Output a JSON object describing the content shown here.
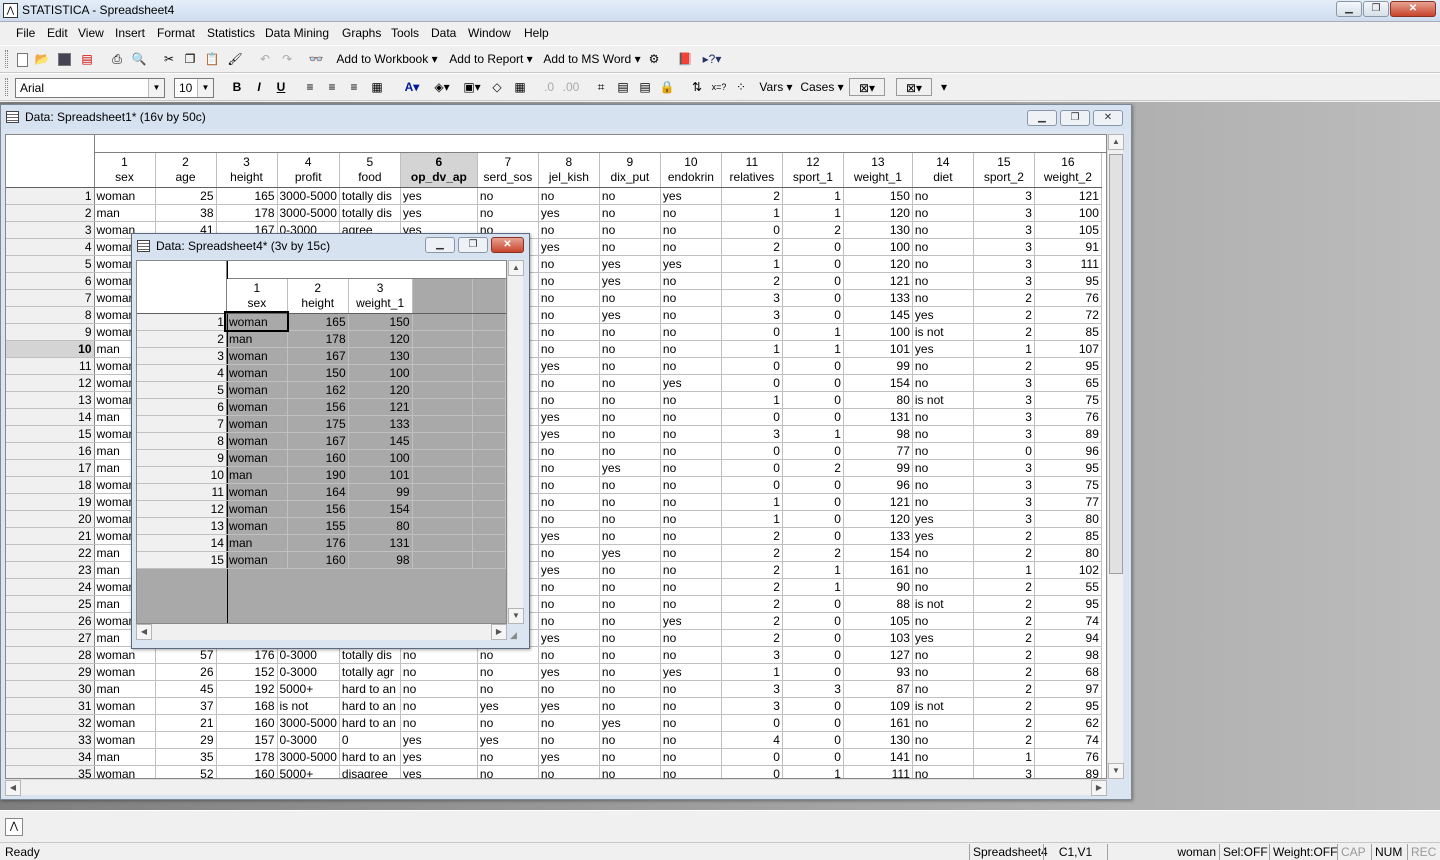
{
  "app": {
    "title": "STATISTICA - Spreadsheet4",
    "icon": "statistica-app-icon"
  },
  "menu": [
    "File",
    "Edit",
    "View",
    "Insert",
    "Format",
    "Statistics",
    "Data Mining",
    "Graphs",
    "Tools",
    "Data",
    "Window",
    "Help"
  ],
  "toolbar1": {
    "add_workbook": "Add to Workbook",
    "add_report": "Add to Report",
    "add_msword": "Add to MS Word"
  },
  "toolbar2": {
    "font": "Arial",
    "size": "10",
    "bold": "B",
    "italic": "I",
    "underline": "U",
    "vars": "Vars",
    "cases": "Cases"
  },
  "win1": {
    "title": "Data: Spreadsheet1* (16v by 50c)",
    "col_nums": [
      "1",
      "2",
      "3",
      "4",
      "5",
      "6",
      "7",
      "8",
      "9",
      "10",
      "11",
      "12",
      "13",
      "14",
      "15",
      "16"
    ],
    "col_names": [
      "sex",
      "age",
      "height",
      "profit",
      "food",
      "op_dv_ap",
      "serd_sos",
      "jel_kish",
      "dix_put",
      "endokrin",
      "relatives",
      "sport_1",
      "weight_1",
      "diet",
      "sport_2",
      "weight_2"
    ],
    "rows": [
      [
        "1",
        "woman",
        "25",
        "165",
        "3000-5000",
        "totally dis",
        "yes",
        "no",
        "no",
        "no",
        "yes",
        "2",
        "1",
        "150",
        "no",
        "3",
        "121"
      ],
      [
        "2",
        "man",
        "38",
        "178",
        "3000-5000",
        "totally dis",
        "yes",
        "no",
        "yes",
        "no",
        "no",
        "1",
        "1",
        "120",
        "no",
        "3",
        "100"
      ],
      [
        "3",
        "woman",
        "41",
        "167",
        "0-3000",
        "agree",
        "yes",
        "no",
        "no",
        "no",
        "no",
        "0",
        "2",
        "130",
        "no",
        "3",
        "105"
      ],
      [
        "4",
        "woman",
        "",
        "",
        "",
        "",
        "",
        "",
        "yes",
        "no",
        "no",
        "2",
        "0",
        "100",
        "no",
        "3",
        "91"
      ],
      [
        "5",
        "woman",
        "",
        "",
        "",
        "",
        "",
        "",
        "no",
        "yes",
        "yes",
        "1",
        "0",
        "120",
        "no",
        "3",
        "111"
      ],
      [
        "6",
        "woman",
        "",
        "",
        "",
        "",
        "",
        "",
        "no",
        "yes",
        "no",
        "2",
        "0",
        "121",
        "no",
        "3",
        "95"
      ],
      [
        "7",
        "woman",
        "",
        "",
        "",
        "",
        "",
        "",
        "no",
        "no",
        "no",
        "3",
        "0",
        "133",
        "no",
        "2",
        "76"
      ],
      [
        "8",
        "woman",
        "",
        "",
        "",
        "",
        "",
        "",
        "no",
        "yes",
        "no",
        "3",
        "0",
        "145",
        "yes",
        "2",
        "72"
      ],
      [
        "9",
        "woman",
        "",
        "",
        "",
        "",
        "",
        "",
        "no",
        "no",
        "no",
        "0",
        "1",
        "100",
        "is not",
        "2",
        "85"
      ],
      [
        "10",
        "man",
        "",
        "",
        "",
        "",
        "",
        "",
        "no",
        "no",
        "no",
        "1",
        "1",
        "101",
        "yes",
        "1",
        "107"
      ],
      [
        "11",
        "woman",
        "",
        "",
        "",
        "",
        "",
        "",
        "yes",
        "no",
        "no",
        "0",
        "0",
        "99",
        "no",
        "2",
        "95"
      ],
      [
        "12",
        "woman",
        "",
        "",
        "",
        "",
        "",
        "",
        "no",
        "no",
        "yes",
        "0",
        "0",
        "154",
        "no",
        "3",
        "65"
      ],
      [
        "13",
        "woman",
        "",
        "",
        "",
        "",
        "",
        "",
        "no",
        "no",
        "no",
        "1",
        "0",
        "80",
        "is not",
        "3",
        "75"
      ],
      [
        "14",
        "man",
        "",
        "",
        "",
        "",
        "",
        "",
        "yes",
        "no",
        "no",
        "0",
        "0",
        "131",
        "no",
        "3",
        "76"
      ],
      [
        "15",
        "woman",
        "",
        "",
        "",
        "",
        "",
        "",
        "yes",
        "no",
        "no",
        "3",
        "1",
        "98",
        "no",
        "3",
        "89"
      ],
      [
        "16",
        "man",
        "",
        "",
        "",
        "",
        "",
        "",
        "no",
        "no",
        "no",
        "0",
        "0",
        "77",
        "no",
        "0",
        "96"
      ],
      [
        "17",
        "man",
        "",
        "",
        "",
        "",
        "",
        "",
        "no",
        "yes",
        "no",
        "0",
        "2",
        "99",
        "no",
        "3",
        "95"
      ],
      [
        "18",
        "woman",
        "",
        "",
        "",
        "",
        "",
        "",
        "no",
        "no",
        "no",
        "0",
        "0",
        "96",
        "no",
        "3",
        "75"
      ],
      [
        "19",
        "woman",
        "",
        "",
        "",
        "",
        "",
        "",
        "no",
        "no",
        "no",
        "1",
        "0",
        "121",
        "no",
        "3",
        "77"
      ],
      [
        "20",
        "woman",
        "",
        "",
        "",
        "",
        "",
        "",
        "no",
        "no",
        "no",
        "1",
        "0",
        "120",
        "yes",
        "3",
        "80"
      ],
      [
        "21",
        "woman",
        "",
        "",
        "",
        "",
        "",
        "",
        "yes",
        "no",
        "no",
        "2",
        "0",
        "133",
        "yes",
        "2",
        "85"
      ],
      [
        "22",
        "man",
        "",
        "",
        "",
        "",
        "",
        "",
        "no",
        "yes",
        "no",
        "2",
        "2",
        "154",
        "no",
        "2",
        "80"
      ],
      [
        "23",
        "man",
        "",
        "",
        "",
        "",
        "",
        "",
        "yes",
        "no",
        "no",
        "2",
        "1",
        "161",
        "no",
        "1",
        "102"
      ],
      [
        "24",
        "woman",
        "",
        "",
        "",
        "",
        "",
        "",
        "no",
        "no",
        "no",
        "2",
        "1",
        "90",
        "no",
        "2",
        "55"
      ],
      [
        "25",
        "man",
        "",
        "",
        "",
        "",
        "",
        "",
        "no",
        "no",
        "no",
        "2",
        "0",
        "88",
        "is not",
        "2",
        "95"
      ],
      [
        "26",
        "woman",
        "",
        "",
        "",
        "",
        "",
        "",
        "no",
        "no",
        "yes",
        "2",
        "0",
        "105",
        "no",
        "2",
        "74"
      ],
      [
        "27",
        "man",
        "",
        "",
        "",
        "",
        "",
        "",
        "yes",
        "no",
        "no",
        "2",
        "0",
        "103",
        "yes",
        "2",
        "94"
      ],
      [
        "28",
        "woman",
        "57",
        "176",
        "0-3000",
        "totally dis",
        "no",
        "no",
        "no",
        "no",
        "no",
        "3",
        "0",
        "127",
        "no",
        "2",
        "98"
      ],
      [
        "29",
        "woman",
        "26",
        "152",
        "0-3000",
        "totally agr",
        "no",
        "no",
        "yes",
        "no",
        "yes",
        "1",
        "0",
        "93",
        "no",
        "2",
        "68"
      ],
      [
        "30",
        "man",
        "45",
        "192",
        "5000+",
        "hard to an",
        "no",
        "no",
        "no",
        "no",
        "no",
        "3",
        "3",
        "87",
        "no",
        "2",
        "97"
      ],
      [
        "31",
        "woman",
        "37",
        "168",
        "is not",
        "hard to an",
        "no",
        "yes",
        "yes",
        "no",
        "no",
        "3",
        "0",
        "109",
        "is not",
        "2",
        "95"
      ],
      [
        "32",
        "woman",
        "21",
        "160",
        "3000-5000",
        "hard to an",
        "no",
        "no",
        "no",
        "yes",
        "no",
        "0",
        "0",
        "161",
        "no",
        "2",
        "62"
      ],
      [
        "33",
        "woman",
        "29",
        "157",
        "0-3000",
        "0",
        "yes",
        "yes",
        "no",
        "no",
        "no",
        "4",
        "0",
        "130",
        "no",
        "2",
        "74"
      ],
      [
        "34",
        "man",
        "35",
        "178",
        "3000-5000",
        "hard to an",
        "yes",
        "no",
        "yes",
        "no",
        "no",
        "0",
        "0",
        "141",
        "no",
        "1",
        "76"
      ],
      [
        "35",
        "woman",
        "52",
        "160",
        "5000+",
        "disagree",
        "yes",
        "no",
        "no",
        "no",
        "no",
        "0",
        "1",
        "111",
        "no",
        "3",
        "89"
      ]
    ]
  },
  "win2": {
    "title": "Data: Spreadsheet4* (3v by 15c)",
    "col_nums": [
      "1",
      "2",
      "3"
    ],
    "col_names": [
      "sex",
      "height",
      "weight_1"
    ],
    "rows": [
      [
        "1",
        "woman",
        "165",
        "150"
      ],
      [
        "2",
        "man",
        "178",
        "120"
      ],
      [
        "3",
        "woman",
        "167",
        "130"
      ],
      [
        "4",
        "woman",
        "150",
        "100"
      ],
      [
        "5",
        "woman",
        "162",
        "120"
      ],
      [
        "6",
        "woman",
        "156",
        "121"
      ],
      [
        "7",
        "woman",
        "175",
        "133"
      ],
      [
        "8",
        "woman",
        "167",
        "145"
      ],
      [
        "9",
        "woman",
        "160",
        "100"
      ],
      [
        "10",
        "man",
        "190",
        "101"
      ],
      [
        "11",
        "woman",
        "164",
        "99"
      ],
      [
        "12",
        "woman",
        "156",
        "154"
      ],
      [
        "13",
        "woman",
        "155",
        "80"
      ],
      [
        "14",
        "man",
        "176",
        "131"
      ],
      [
        "15",
        "woman",
        "160",
        "98"
      ]
    ]
  },
  "status": {
    "ready": "Ready",
    "sheet": "Spreadsheet4",
    "cell": "C1,V1",
    "value": "woman",
    "sel": "Sel:OFF",
    "weight": "Weight:OFF",
    "cap": "CAP",
    "num": "NUM",
    "rec": "REC"
  }
}
